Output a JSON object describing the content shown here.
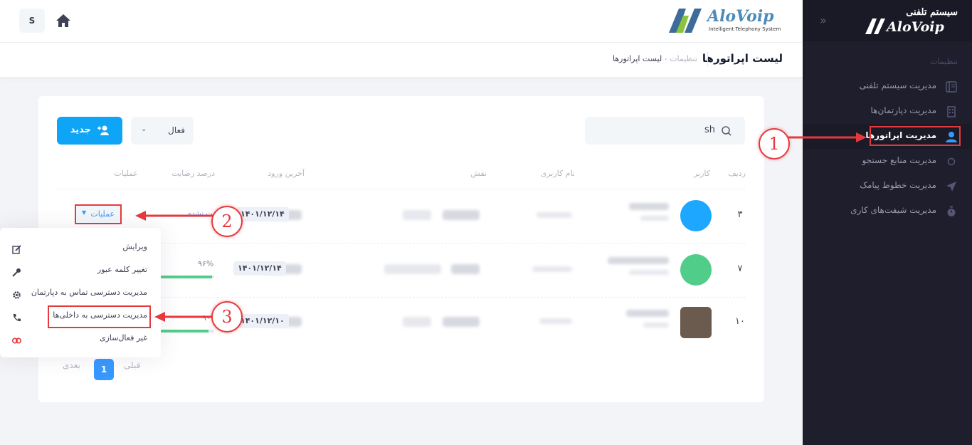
{
  "sidebar": {
    "brand_text": "سیستم تلفنی",
    "logo_word": "AloVoip",
    "section_title": "تنظیمات",
    "items": [
      {
        "label": "مدیریت سیستم تلفنی",
        "icon": "book-icon"
      },
      {
        "label": "مدیریت دپارتمان‌ها",
        "icon": "building-icon"
      },
      {
        "label": "مدیریت اپراتورها",
        "icon": "user-icon",
        "active": true
      },
      {
        "label": "مدیریت منابع جستجو",
        "icon": "circle-icon"
      },
      {
        "label": "مدیریت خطوط پیامک",
        "icon": "send-icon"
      },
      {
        "label": "مدیریت شیفت‌های کاری",
        "icon": "stopwatch-icon"
      }
    ]
  },
  "header": {
    "user_initial": "S",
    "logo_word": "AloVoip",
    "logo_tagline": "Intelligent Telephony System"
  },
  "subheader": {
    "title": "لیست اپراتورها",
    "crumb_parent": "تنظیمات",
    "crumb_sep": "-",
    "crumb_current": "لیست اپراتورها"
  },
  "toolbar": {
    "search_value": "sh",
    "filter_value": "فعال",
    "new_label": "جدید"
  },
  "table": {
    "headers": {
      "row": "ردیف",
      "user": "کاربر",
      "username": "نام کاربری",
      "role": "نقش",
      "last_login": "آخرین ورود",
      "satisfaction": "درصد رضایت",
      "actions": "عملیات"
    },
    "rows": [
      {
        "num": "۳",
        "date": "۱۴۰۱/۱۲/۱۴",
        "satisfaction_text": "نظری ثبت نشده",
        "avatar_color": "#1ea7ff"
      },
      {
        "num": "۷",
        "date": "۱۴۰۱/۱۲/۱۴",
        "satisfaction_text": "۹۶%",
        "satisfaction": 0.96,
        "avatar_color": "#50cd89"
      },
      {
        "num": "۱۰",
        "date": "۱۴۰۱/۱۲/۱۰",
        "satisfaction_text": "۹۰%",
        "satisfaction": 0.9,
        "avatar_color": "#6b5a4e"
      }
    ],
    "actions_label": "عملیات"
  },
  "dropdown": {
    "items": [
      {
        "label": "ویرایش",
        "icon": "edit-icon"
      },
      {
        "label": "تغییر کلمه عبور",
        "icon": "key-icon"
      },
      {
        "label": "مدیریت دسترسی تماس به دپارتمان",
        "icon": "gear-icon"
      },
      {
        "label": "مدیریت دسترسی به داخلی‌ها",
        "icon": "phone-icon"
      },
      {
        "label": "غیر فعال‌سازی",
        "icon": "toggle-icon"
      }
    ]
  },
  "pagination": {
    "prev": "قبلی",
    "current": "1",
    "next": "بعدی"
  },
  "annotations": {
    "one": "1",
    "two": "2",
    "three": "3"
  },
  "colors": {
    "accent": "#3699ff",
    "primary_button": "#0ea5f7",
    "annotation": "#e5393e",
    "sidebar": "#1e1e2d",
    "progress": "#50cd89"
  }
}
